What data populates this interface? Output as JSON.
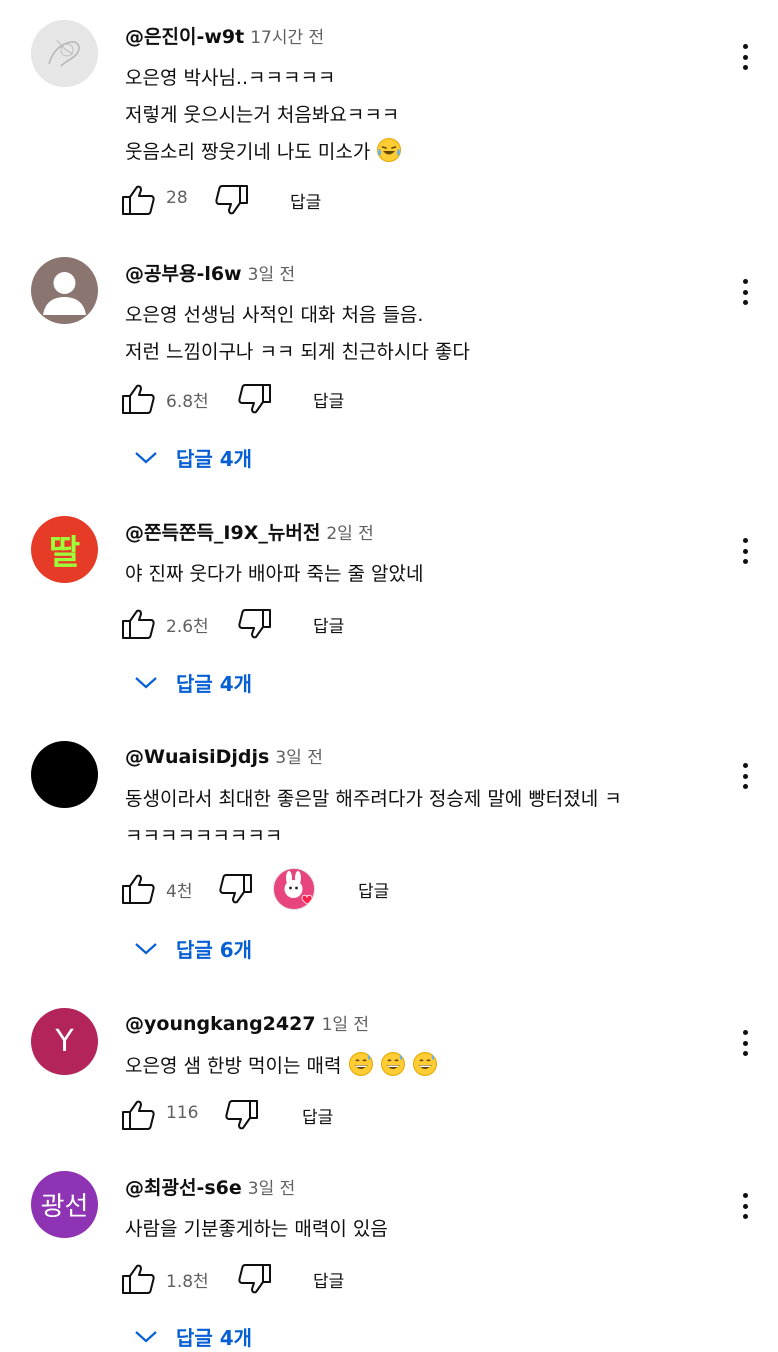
{
  "comments": [
    {
      "author": "@은진이-w9t",
      "time": "17시간 전",
      "lines": [
        "오은영 박사님..ㅋㅋㅋㅋㅋ",
        "저렇게 웃으시는거 처음봐요ㅋㅋㅋ",
        "웃음소리 짱웃기네 나도 미소가"
      ],
      "line_emoji": "laughing-tears-emoji",
      "likes": "28",
      "reply_label": "답글"
    },
    {
      "author": "@공부용-l6w",
      "time": "3일 전",
      "lines": [
        "오은영 선생님 사적인 대화 처음 들음.",
        "저런 느낌이구나 ㅋㅋ 되게 친근하시다 좋다"
      ],
      "likes": "6.8천",
      "reply_label": "답글",
      "replies_label": "답글 4개"
    },
    {
      "author": "@쫀득쫀득_I9X_뉴버전",
      "time": "2일 전",
      "avatar_text": "딸",
      "lines": [
        "야 진짜 웃다가 배아파 죽는 줄 알았네"
      ],
      "likes": "2.6천",
      "reply_label": "답글",
      "replies_label": "답글 4개"
    },
    {
      "author": "@WuaisiDjdjs",
      "time": "3일 전",
      "lines": [
        "동생이라서 최대한 좋은말 해주려다가 정승제 말에 빵터졌네 ㅋ",
        "ㅋㅋㅋㅋㅋㅋㅋㅋㅋ"
      ],
      "likes": "4천",
      "creator_heart": "creator-heart-badge",
      "reply_label": "답글",
      "replies_label": "답글 6개"
    },
    {
      "author": "@youngkang2427",
      "time": "1일 전",
      "avatar_text": "Y",
      "lines": [
        "오은영 샘 한방 먹이는 매력"
      ],
      "line_emoji": "grinning-sweat-emoji",
      "line_emoji_count": 3,
      "likes": "116",
      "reply_label": "답글"
    },
    {
      "author": "@최광선-s6e",
      "time": "3일 전",
      "avatar_text": "광선",
      "lines": [
        "사람을 기분좋게하는 매력이 있음"
      ],
      "likes": "1.8천",
      "reply_label": "답글",
      "replies_label": "답글 4개"
    }
  ],
  "icons": {
    "like": "thumbs-up-icon",
    "dislike": "thumbs-down-icon",
    "menu": "more-vert-icon",
    "expand": "chevron-down-icon"
  },
  "colors": {
    "link_blue": "#065fd4",
    "meta_gray": "#606060",
    "text": "#0f0f0f"
  }
}
